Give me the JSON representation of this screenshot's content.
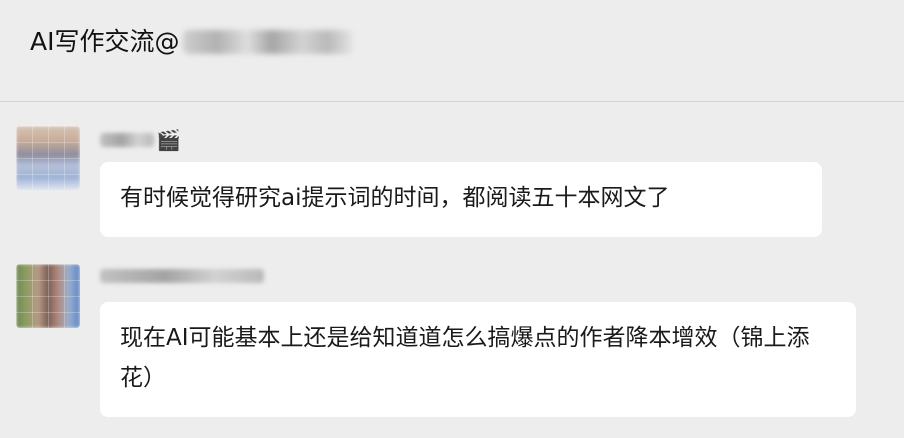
{
  "header": {
    "title": "AI写作交流@"
  },
  "messages": [
    {
      "sender": "",
      "sender_emoji": "🎬",
      "text": "有时候觉得研究ai提示词的时间，都阅读五十本网文了"
    },
    {
      "sender": "",
      "sender_emoji": "",
      "text": "现在AI可能基本上还是给知道道怎么搞爆点的作者降本增效（锦上添花）"
    }
  ],
  "colors": {
    "background": "#ededed",
    "bubble": "#ffffff",
    "divider": "#d6d6d6",
    "name_text": "#8a8a8a",
    "body_text": "#1a1a1a"
  }
}
